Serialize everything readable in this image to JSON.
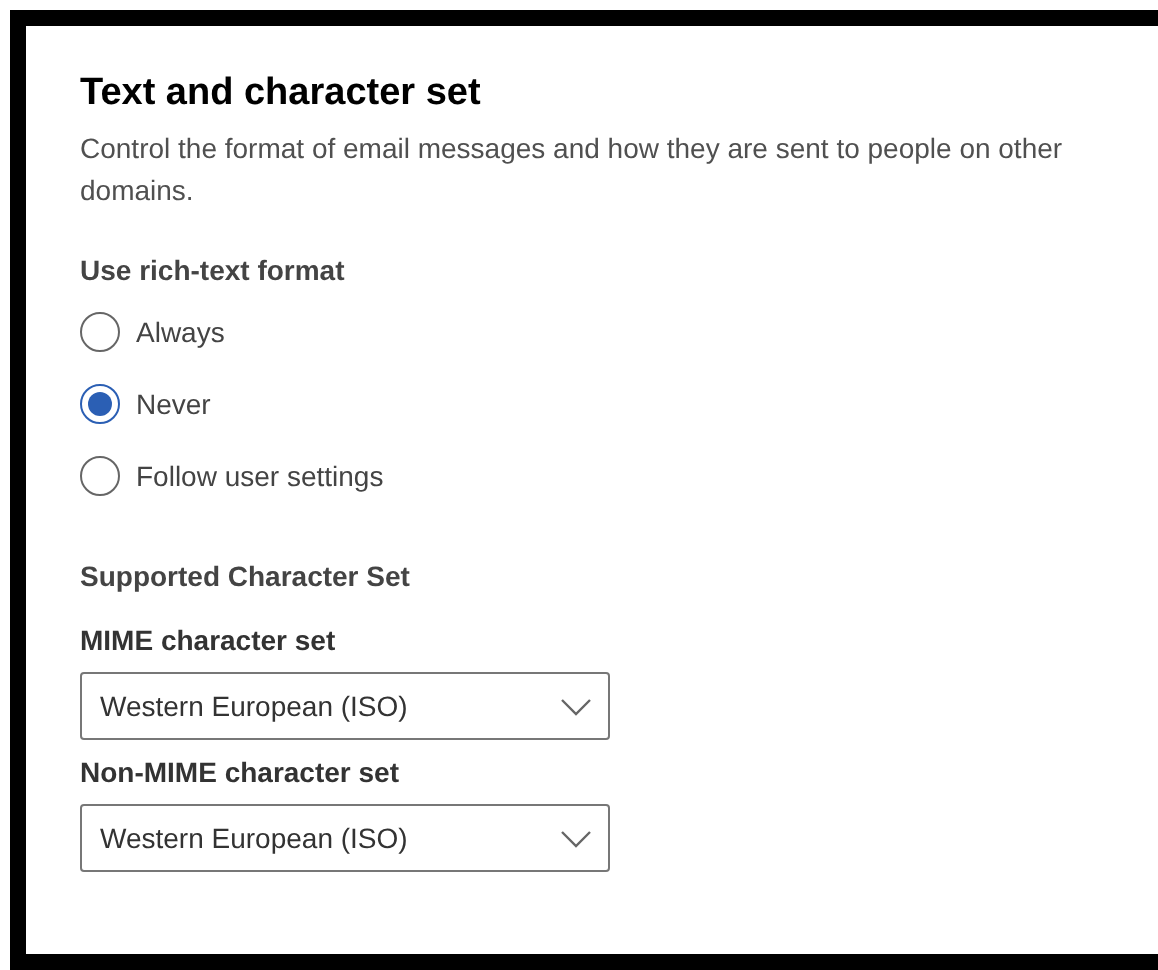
{
  "title": "Text and character set",
  "description": "Control the format of email messages and how they are sent to people on other domains.",
  "rich_text": {
    "label": "Use rich-text format",
    "options": [
      {
        "label": "Always",
        "selected": false
      },
      {
        "label": "Never",
        "selected": true
      },
      {
        "label": "Follow user settings",
        "selected": false
      }
    ]
  },
  "character_set": {
    "heading": "Supported Character Set",
    "dropdowns": [
      {
        "label": "MIME character set",
        "value": "Western European (ISO)"
      },
      {
        "label": "Non-MIME character set",
        "value": "Western European (ISO)"
      }
    ]
  }
}
